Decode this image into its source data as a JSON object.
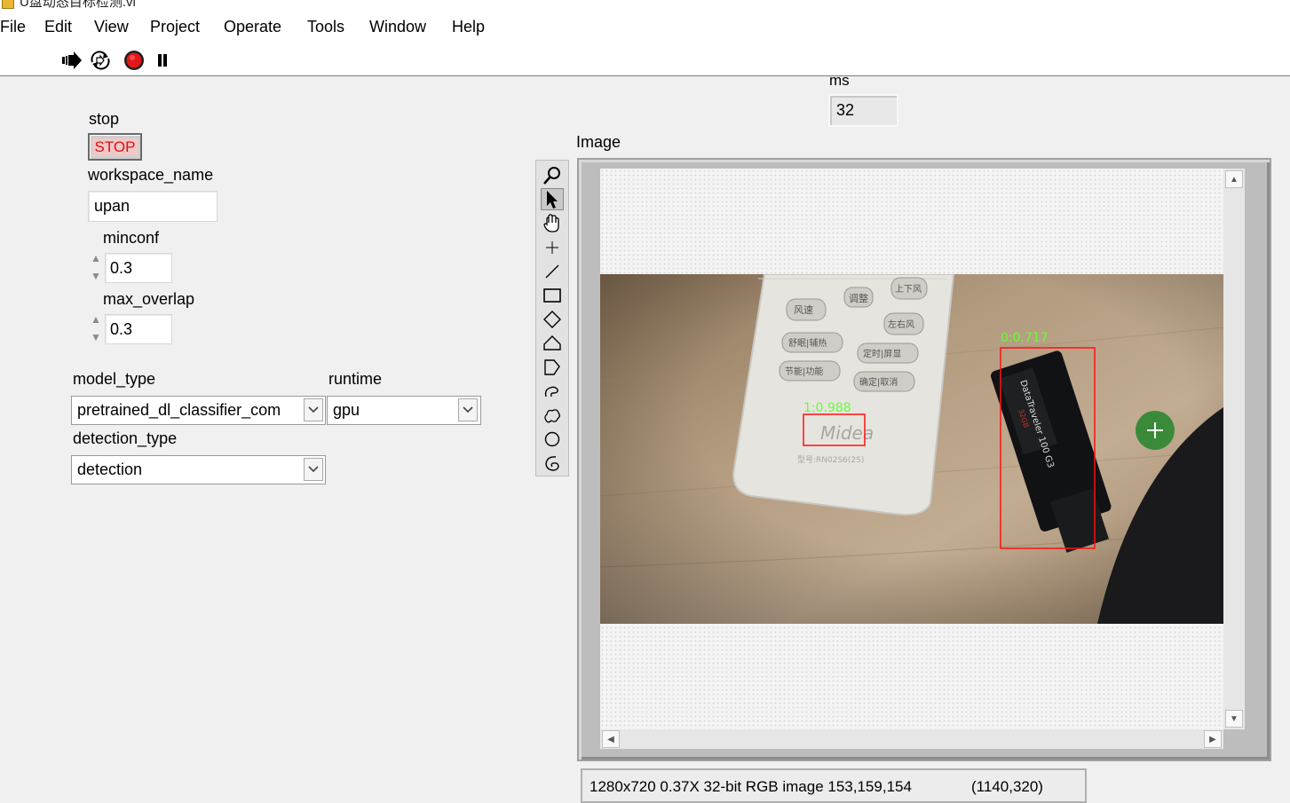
{
  "window": {
    "title": "U盘动态目标检测.vi"
  },
  "menu": [
    "File",
    "Edit",
    "View",
    "Project",
    "Operate",
    "Tools",
    "Window",
    "Help"
  ],
  "toolbar": {
    "run_icon": "run-arrow-icon",
    "run_continuous_icon": "run-continuously-icon",
    "abort_icon": "abort-execution-icon",
    "pause_icon": "pause-icon"
  },
  "controls": {
    "stop": {
      "label": "stop",
      "button_text": "STOP"
    },
    "workspace_name": {
      "label": "workspace_name",
      "value": "upan"
    },
    "minconf": {
      "label": "minconf",
      "value": "0.3"
    },
    "max_overlap": {
      "label": "max_overlap",
      "value": "0.3"
    },
    "model_type": {
      "label": "model_type",
      "value": "pretrained_dl_classifier_com"
    },
    "runtime": {
      "label": "runtime",
      "value": "gpu"
    },
    "detection_type": {
      "label": "detection_type",
      "value": "detection"
    },
    "ms": {
      "label": "ms",
      "value": "32"
    }
  },
  "image_display": {
    "label": "Image",
    "detections": [
      {
        "label": "1:0.988",
        "color": "#ff1010"
      },
      {
        "label": "0:0.717",
        "color": "#ff1010"
      }
    ],
    "remote_text": [
      "调整",
      "风速",
      "上下风",
      "左右风",
      "舒眠|辅热",
      "定时|屏显",
      "节能|功能",
      "确定|取消",
      "Midea",
      "型号:RN02S6(2S)"
    ],
    "label_color": "#66ff33",
    "status": "1280x720 0.37X 32-bit RGB image 153,159,154",
    "status_coord": "(1140,320)"
  },
  "palette_tools": [
    "zoom-icon",
    "select-pointer-icon",
    "pan-hand-icon",
    "point-crosshair-icon",
    "line-icon",
    "rectangle-icon",
    "rotated-rectangle-icon",
    "annulus-icon",
    "polygon-icon",
    "freehand-icon",
    "broken-line-icon",
    "oval-icon",
    "annulus-arc-icon"
  ]
}
